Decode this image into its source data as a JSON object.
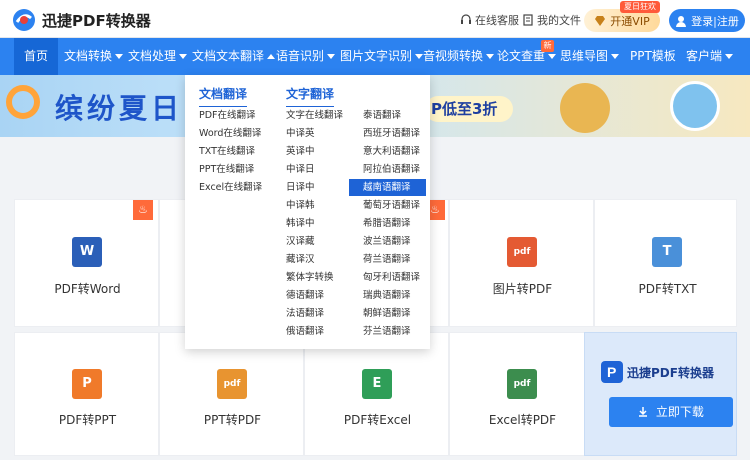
{
  "header": {
    "brand": "迅捷PDF转换器",
    "service": "在线客服",
    "my_files": "我的文件",
    "vip": "开通VIP",
    "vip_tag": "夏日狂欢",
    "login": "登录|注册"
  },
  "nav": {
    "items": [
      "首页",
      "文档转换",
      "文档处理",
      "文档文本翻译",
      "语音识别",
      "图片文字识别",
      "音视频转换",
      "论文查重",
      "思维导图",
      "PPT模板",
      "客户端"
    ],
    "new_tag": "新"
  },
  "banner": {
    "title": "缤纷夏日",
    "promo": "P低至3折"
  },
  "dropdown": {
    "col1_title": "文档翻译",
    "col1": [
      "PDF在线翻译",
      "Word在线翻译",
      "TXT在线翻译",
      "PPT在线翻译",
      "Excel在线翻译"
    ],
    "col2_title": "文字翻译",
    "col2": [
      "文字在线翻译",
      "中译英",
      "英译中",
      "中译日",
      "日译中",
      "中译韩",
      "韩译中",
      "汉译藏",
      "藏译汉",
      "繁体字转换",
      "德语翻译",
      "法语翻译",
      "俄语翻译"
    ],
    "col3": [
      "泰语翻译",
      "西班牙语翻译",
      "意大利语翻译",
      "阿拉伯语翻译",
      "越南语翻译",
      "葡萄牙语翻译",
      "希腊语翻译",
      "波兰语翻译",
      "荷兰语翻译",
      "匈牙利语翻译",
      "瑞典语翻译",
      "朝鲜语翻译",
      "芬兰语翻译"
    ],
    "active": "越南语翻译"
  },
  "cards": {
    "row1": [
      {
        "label": "PDF转Word",
        "icon": "W",
        "color": "#2b5fb8"
      },
      {
        "label": "图片转PDF",
        "icon": "pdf",
        "color": "#e45a33"
      },
      {
        "label": "PDF转TXT",
        "icon": "T",
        "color": "#4a90d9"
      }
    ],
    "row2": [
      {
        "label": "PDF转PPT",
        "icon": "P",
        "color": "#f07a2a"
      },
      {
        "label": "PPT转PDF",
        "icon": "pdf",
        "color": "#e89430"
      },
      {
        "label": "PDF转Excel",
        "icon": "E",
        "color": "#2f9e58"
      },
      {
        "label": "Excel转PDF",
        "icon": "pdf",
        "color": "#3c8d4e"
      }
    ]
  },
  "download": {
    "name": "迅捷PDF转换器",
    "button": "立即下载"
  }
}
